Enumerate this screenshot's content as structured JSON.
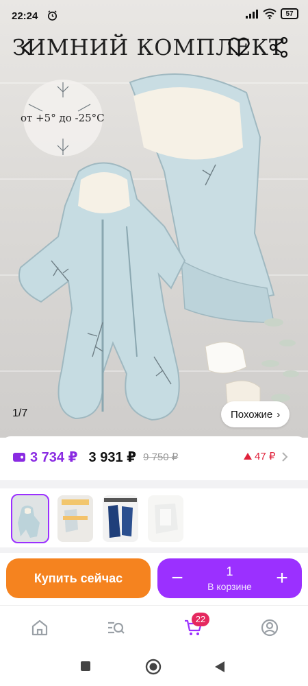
{
  "status_bar": {
    "time": "22:24",
    "battery": "57",
    "icons": [
      "alarm-icon",
      "signal-icon",
      "wifi-icon",
      "battery-icon"
    ]
  },
  "hero": {
    "title_text": "ЗИМНИЙ КОМПЛЕКТ",
    "temperature_text": "от +5° до -25°С",
    "counter": "1/7",
    "similar_label": "Похожие",
    "back_icon": "chevron-left-icon",
    "favorite_icon": "heart-icon",
    "share_icon": "share-icon"
  },
  "prices": {
    "card_price": "3 734 ₽",
    "price": "3 931 ₽",
    "old_price": "9 750 ₽",
    "change": "47 ₽",
    "change_icon": "triangle-up-icon",
    "colors": {
      "card": "#8a2be2",
      "change": "#e0223b"
    }
  },
  "thumbnails": [
    {
      "label": "thumbnail-1",
      "active": true
    },
    {
      "label": "thumbnail-2",
      "active": false
    },
    {
      "label": "thumbnail-3",
      "active": false
    },
    {
      "label": "thumbnail-4",
      "active": false
    }
  ],
  "actions": {
    "buy_now": "Купить сейчас",
    "quantity": "1",
    "in_cart": "В корзине",
    "minus": "−",
    "plus": "+",
    "colors": {
      "buy": "#f5831f",
      "cart": "#9b30ff"
    }
  },
  "bottom_nav": {
    "items": [
      "home-icon",
      "catalog-search-icon",
      "cart-icon",
      "profile-icon"
    ],
    "cart_badge": "22"
  },
  "system_nav": [
    "recents-button",
    "home-button",
    "back-button"
  ]
}
